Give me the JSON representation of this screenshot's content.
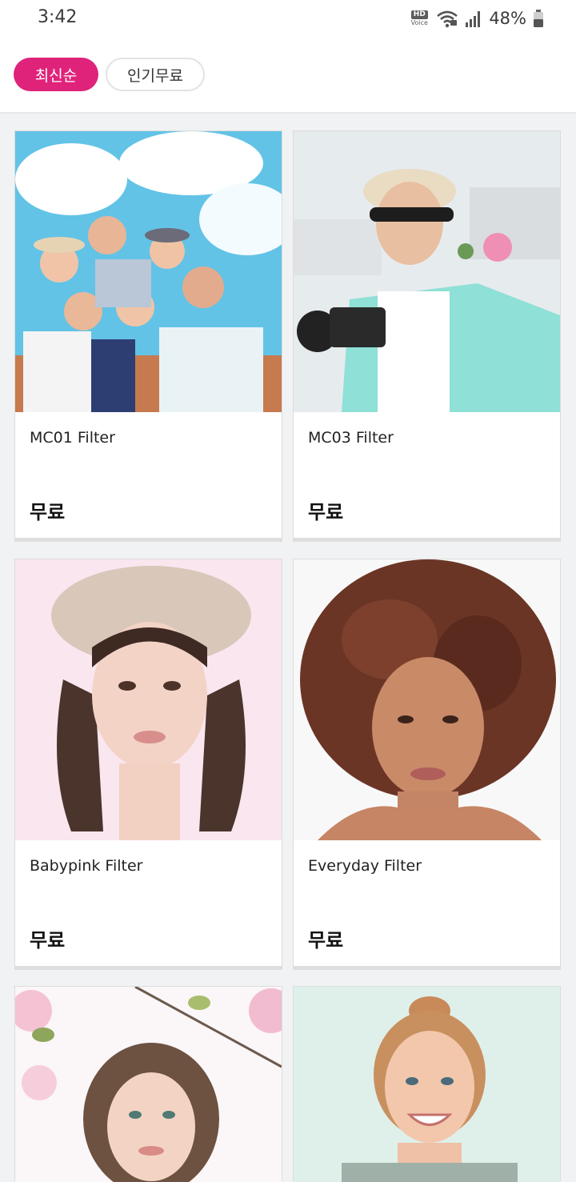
{
  "status_bar": {
    "time": "3:42",
    "hd_label": "HD",
    "voice_label": "Voice",
    "battery_percent": "48%",
    "icons": [
      "hd-voice-icon",
      "wifi-icon",
      "signal-icon",
      "battery-icon"
    ]
  },
  "filters": {
    "tabs": [
      {
        "label": "최신순",
        "active": true
      },
      {
        "label": "인기무료",
        "active": false
      }
    ],
    "accent_color": "#e0237a"
  },
  "cards": [
    {
      "name": "MC01 Filter",
      "price": "무료",
      "photo": "group-selfie-photo"
    },
    {
      "name": "MC03 Filter",
      "price": "무료",
      "photo": "man-with-camera-photo"
    },
    {
      "name": "Babypink Filter",
      "price": "무료",
      "photo": "woman-in-hat-photo"
    },
    {
      "name": "Everyday Filter",
      "price": "무료",
      "photo": "curly-hair-woman-photo"
    },
    {
      "name": "",
      "price": "",
      "photo": "girl-with-blossoms-photo"
    },
    {
      "name": "",
      "price": "",
      "photo": "smiling-girl-photo"
    }
  ]
}
